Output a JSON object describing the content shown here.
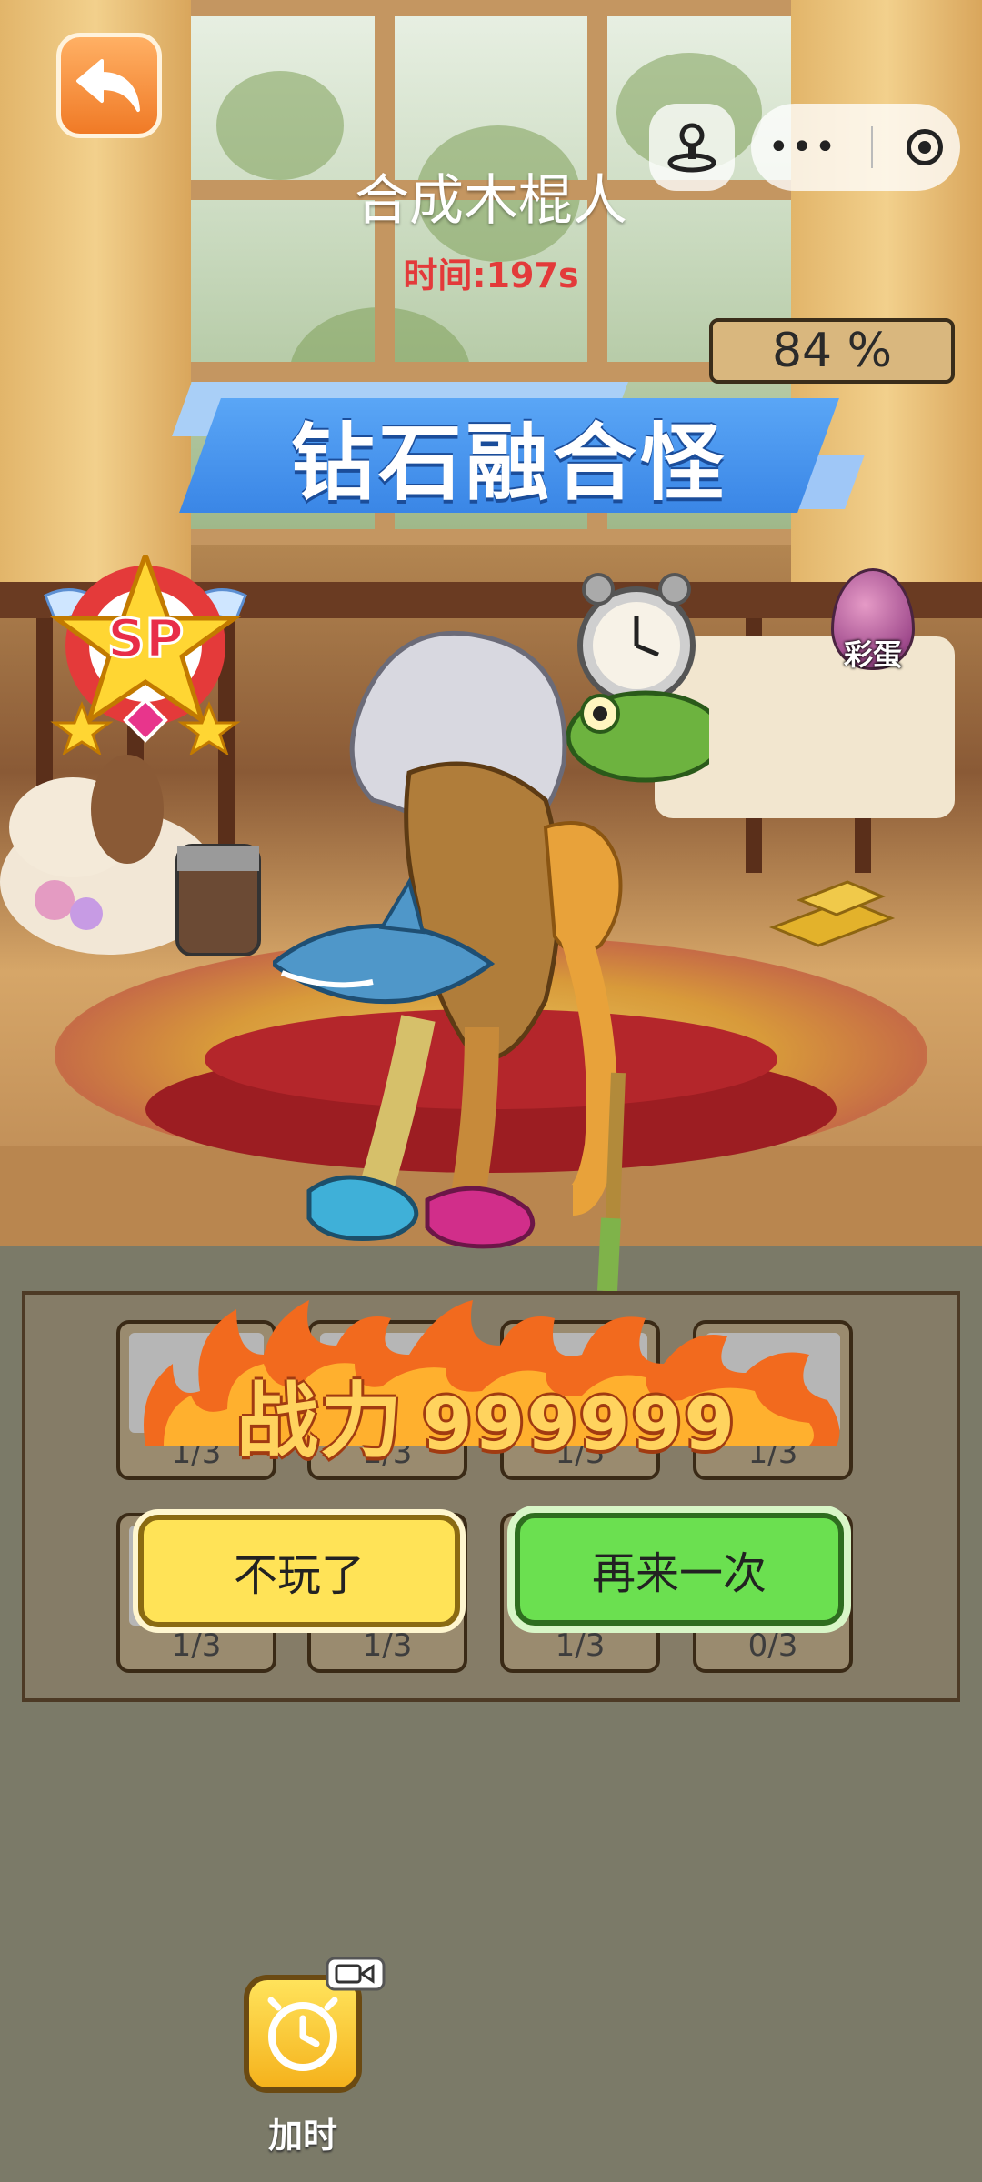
{
  "header": {
    "title": "合成木棍人",
    "timer": "时间:197s",
    "progress": "84 %"
  },
  "banner": {
    "text": "钻石融合怪"
  },
  "badges": {
    "sp": "SP",
    "egg": "彩蛋"
  },
  "result": {
    "power_label": "战力",
    "power_value": "999999",
    "slots": [
      "1/3",
      "1/3",
      "1/3",
      "1/3",
      "1/3",
      "1/3",
      "1/3",
      "0/3"
    ]
  },
  "buttons": {
    "quit": "不玩了",
    "again": "再来一次"
  },
  "footer": {
    "add_time": "加时"
  },
  "icons": [
    "back-arrow-icon",
    "joystick-icon",
    "more-icon",
    "target-icon",
    "clock-icon",
    "video-icon",
    "sp-star-badge-icon",
    "egg-icon",
    "fire-icon"
  ],
  "colors": {
    "banner": "#3a86e6",
    "quit_button": "#ffe357",
    "again_button": "#6be050",
    "timer": "#e33a3a"
  }
}
